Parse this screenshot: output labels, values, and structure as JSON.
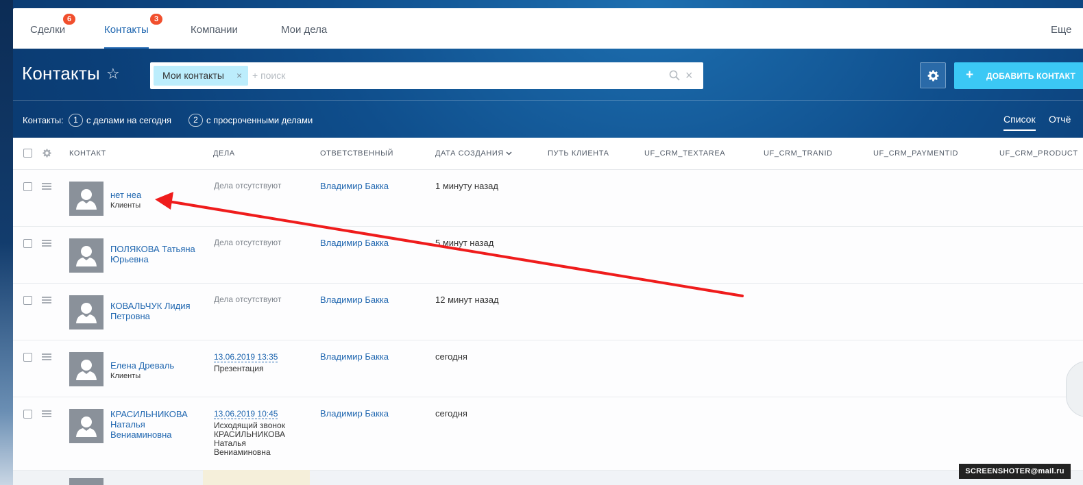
{
  "nav": {
    "items": [
      {
        "label": "Сделки",
        "badge": "6"
      },
      {
        "label": "Контакты",
        "badge": "3"
      },
      {
        "label": "Компании",
        "badge": ""
      },
      {
        "label": "Мои дела",
        "badge": ""
      }
    ],
    "more": "Еще"
  },
  "header": {
    "title": "Контакты",
    "filter_chip": "Мои контакты",
    "search_placeholder": "+ поиск",
    "add_button": "ДОБАВИТЬ КОНТАКТ"
  },
  "counters": {
    "label": "Контакты:",
    "items": [
      {
        "count": "1",
        "text": "с делами на сегодня"
      },
      {
        "count": "2",
        "text": "с просроченными делами"
      }
    ]
  },
  "views": {
    "list": "Список",
    "report": "Отчё"
  },
  "table": {
    "columns": [
      "КОНТАКТ",
      "ДЕЛА",
      "ОТВЕТСТВЕННЫЙ",
      "ДАТА СОЗДАНИЯ",
      "ПУТЬ КЛИЕНТА",
      "UF_CRM_TEXTAREA",
      "UF_CRM_TRANID",
      "UF_CRM_PAYMENTID",
      "UF_CRM_PRODUCT"
    ],
    "rows": [
      {
        "name": "нет неа",
        "sub": "Клиенты",
        "activity_date": "",
        "activity": "Дела отсутствуют",
        "responsible": "Владимир Бакка",
        "created": "1 минуту назад"
      },
      {
        "name": "ПОЛЯКОВА Татьяна Юрьевна",
        "sub": "",
        "activity_date": "",
        "activity": "Дела отсутствуют",
        "responsible": "Владимир Бакка",
        "created": "5 минут назад"
      },
      {
        "name": "КОВАЛЬЧУК Лидия Петровна",
        "sub": "",
        "activity_date": "",
        "activity": "Дела отсутствуют",
        "responsible": "Владимир Бакка",
        "created": "12 минут назад"
      },
      {
        "name": "Елена Древаль",
        "sub": "Клиенты",
        "activity_date": "13.06.2019 13:35",
        "activity": "Презентация",
        "responsible": "Владимир Бакка",
        "created": "сегодня"
      },
      {
        "name": "КРАСИЛЬНИКОВА Наталья Вениаминовна",
        "sub": "",
        "activity_date": "13.06.2019 10:45",
        "activity": "Исходящий звонок КРАСИЛЬНИКОВА Наталья Вениаминовна",
        "responsible": "Владимир Бакка",
        "created": "сегодня"
      }
    ]
  },
  "watermark": "SCREENSHOTER@mail.ru",
  "colors": {
    "accent": "#2067b0",
    "badge": "#f14f2d",
    "add_button": "#3bc8f5",
    "annotation_arrow": "#ef1c1c"
  }
}
